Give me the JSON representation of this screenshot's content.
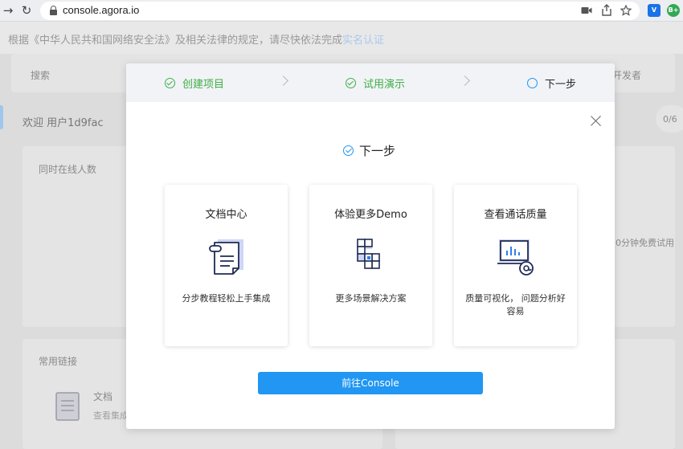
{
  "browser": {
    "url": "console.agora.io",
    "back_glyph": "→",
    "reload_glyph": "↻",
    "ext_v": "V",
    "ext_profile": "B+"
  },
  "notice": {
    "text": "根据《中华人民共和国网络安全法》及相关法律的规定，请尽快依法完成",
    "link": "实名认证"
  },
  "background": {
    "search_placeholder": "搜索",
    "dev_menu": "开发者",
    "welcome": "欢迎 用户1d9fac",
    "counter": "0/6",
    "online_users": "同时在线人数",
    "free_trial": "0分钟免费试用",
    "common_links": "常用链接",
    "doc_title": "文档",
    "doc_desc": "查看集成"
  },
  "modal": {
    "steps": [
      {
        "label": "创建项目",
        "status": "done"
      },
      {
        "label": "试用演示",
        "status": "done"
      },
      {
        "label": "下一步",
        "status": "current"
      }
    ],
    "title": "下一步",
    "cards": [
      {
        "title": "文档中心",
        "desc": "分步教程轻松上手集成",
        "icon": "document-icon"
      },
      {
        "title": "体验更多Demo",
        "desc": "更多场景解决方案",
        "icon": "blocks-icon"
      },
      {
        "title": "查看通话质量",
        "desc": "质量可视化， 问题分析好容易",
        "icon": "quality-chart-icon"
      }
    ],
    "button_label": "前往Console"
  },
  "colors": {
    "accent": "#2196f3",
    "success": "#3fae48",
    "icon_navy": "#1e2b55",
    "icon_light": "#cfd6f5"
  }
}
